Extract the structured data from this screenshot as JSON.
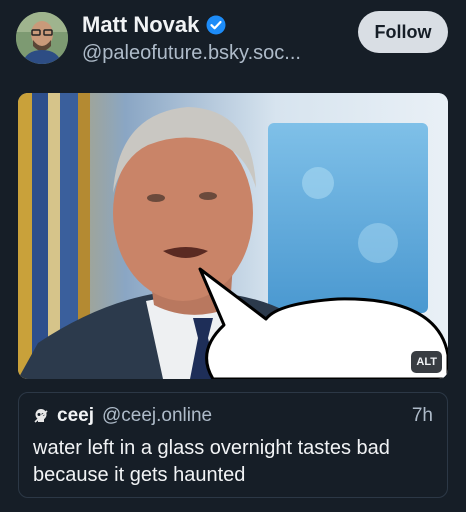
{
  "author": {
    "display_name": "Matt Novak",
    "handle": "@paleofuture.bsky.soc...",
    "verified_icon": "verified-check-icon",
    "avatar": "avatar"
  },
  "actions": {
    "follow_label": "Follow"
  },
  "media": {
    "alt_badge": "ALT",
    "description_icon": "photo-with-speech-bubble"
  },
  "quote": {
    "display_name": "ceej",
    "handle": "@ceej.online",
    "time": "7h",
    "text": "water left in a glass overnight tastes bad because it gets haunted"
  },
  "colors": {
    "background": "#161e27",
    "verified": "#1d8cf8",
    "follow_bg": "#d9dee4",
    "muted_text": "#aebbc9"
  }
}
